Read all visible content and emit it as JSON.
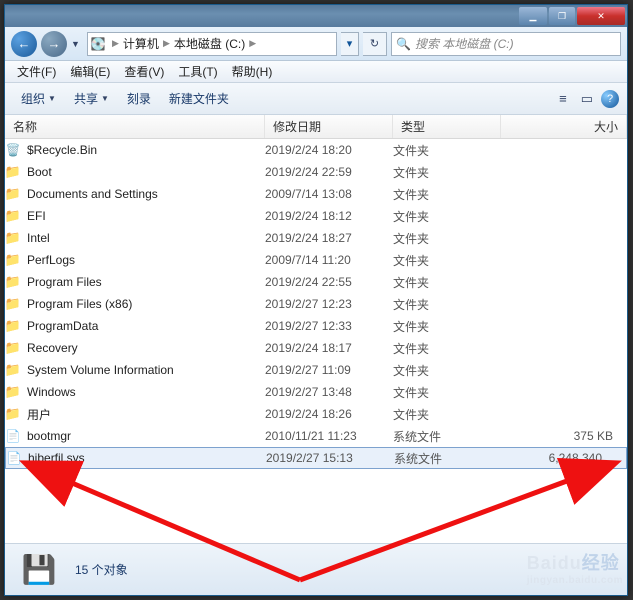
{
  "window_controls": {
    "min": "▁",
    "max": "❐",
    "close": "✕"
  },
  "nav": {
    "back": "←",
    "forward": "→",
    "dropdown": "▼",
    "refresh": "↻",
    "dd": "▾"
  },
  "breadcrumb": {
    "root": "计算机",
    "drive": "本地磁盘 (C:)",
    "sep": "▶"
  },
  "search": {
    "placeholder": "搜索 本地磁盘 (C:)",
    "icon": "🔍"
  },
  "menu": {
    "file": "文件(F)",
    "edit": "编辑(E)",
    "view": "查看(V)",
    "tools": "工具(T)",
    "help": "帮助(H)"
  },
  "toolbar": {
    "organize": "组织",
    "share": "共享",
    "burn": "刻录",
    "newfolder": "新建文件夹",
    "dd": "▼",
    "viewmode": "≡",
    "pane": "▭",
    "help": "?"
  },
  "columns": {
    "name": "名称",
    "date": "修改日期",
    "type": "类型",
    "size": "大小"
  },
  "files": [
    {
      "icon": "bin",
      "name": "$Recycle.Bin",
      "date": "2019/2/24 18:20",
      "type": "文件夹",
      "size": ""
    },
    {
      "icon": "folder",
      "name": "Boot",
      "date": "2019/2/24 22:59",
      "type": "文件夹",
      "size": ""
    },
    {
      "icon": "folder",
      "name": "Documents and Settings",
      "date": "2009/7/14 13:08",
      "type": "文件夹",
      "size": ""
    },
    {
      "icon": "folder",
      "name": "EFI",
      "date": "2019/2/24 18:12",
      "type": "文件夹",
      "size": ""
    },
    {
      "icon": "folder",
      "name": "Intel",
      "date": "2019/2/24 18:27",
      "type": "文件夹",
      "size": ""
    },
    {
      "icon": "folder",
      "name": "PerfLogs",
      "date": "2009/7/14 11:20",
      "type": "文件夹",
      "size": ""
    },
    {
      "icon": "folder",
      "name": "Program Files",
      "date": "2019/2/24 22:55",
      "type": "文件夹",
      "size": ""
    },
    {
      "icon": "folder",
      "name": "Program Files (x86)",
      "date": "2019/2/27 12:23",
      "type": "文件夹",
      "size": ""
    },
    {
      "icon": "folder",
      "name": "ProgramData",
      "date": "2019/2/27 12:33",
      "type": "文件夹",
      "size": ""
    },
    {
      "icon": "folder",
      "name": "Recovery",
      "date": "2019/2/24 18:17",
      "type": "文件夹",
      "size": ""
    },
    {
      "icon": "folder",
      "name": "System Volume Information",
      "date": "2019/2/27 11:09",
      "type": "文件夹",
      "size": ""
    },
    {
      "icon": "folder",
      "name": "Windows",
      "date": "2019/2/27 13:48",
      "type": "文件夹",
      "size": ""
    },
    {
      "icon": "folder",
      "name": "用户",
      "date": "2019/2/24 18:26",
      "type": "文件夹",
      "size": ""
    },
    {
      "icon": "file",
      "name": "bootmgr",
      "date": "2010/11/21 11:23",
      "type": "系统文件",
      "size": "375 KB"
    },
    {
      "icon": "file",
      "name": "hiberfil.sys",
      "date": "2019/2/27 15:13",
      "type": "系统文件",
      "size": "6,248,340...",
      "selected": true
    }
  ],
  "status": {
    "icon": "💾",
    "text": "15 个对象"
  },
  "watermark": {
    "brand": "Baidu",
    "sub": "jingyan.baidu.com",
    "jy": "经验"
  }
}
